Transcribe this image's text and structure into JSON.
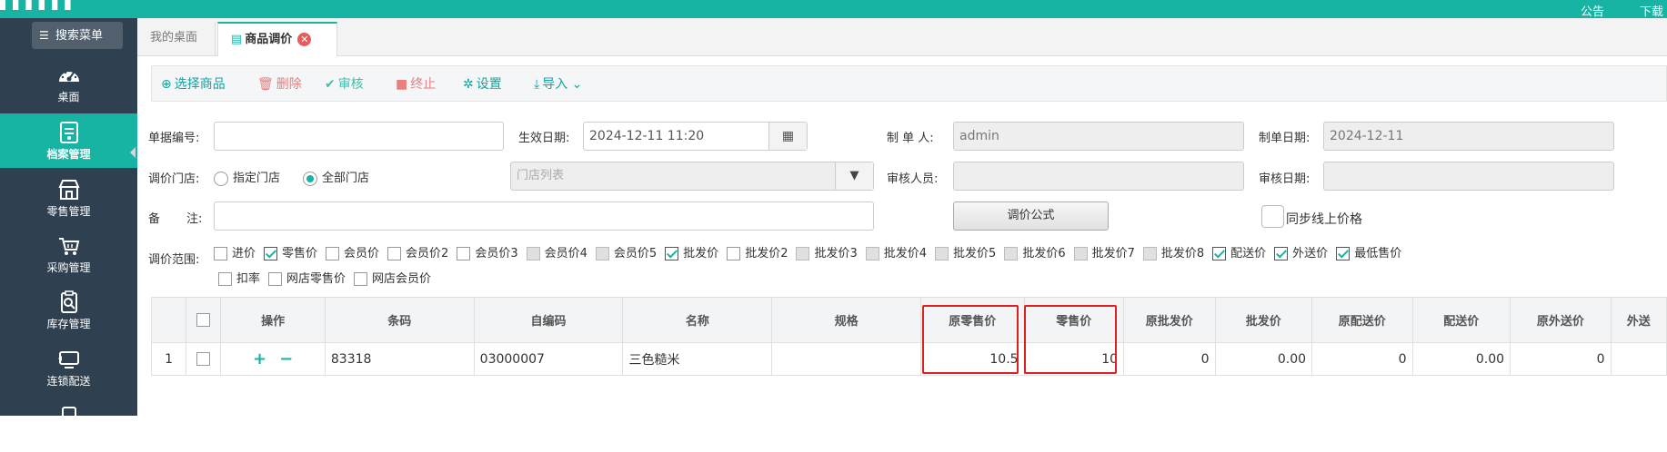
{
  "topbar": {
    "notice": "公告",
    "download": "下载"
  },
  "sidebar": {
    "search_label": "搜索菜单",
    "items": [
      {
        "label": "桌面",
        "icon": "dashboard-icon"
      },
      {
        "label": "档案管理",
        "icon": "archive-icon"
      },
      {
        "label": "零售管理",
        "icon": "store-icon"
      },
      {
        "label": "采购管理",
        "icon": "basket-icon"
      },
      {
        "label": "库存管理",
        "icon": "inventory-icon"
      },
      {
        "label": "连锁配送",
        "icon": "delivery-icon"
      }
    ]
  },
  "tabs": {
    "home": "我的桌面",
    "active": "商品调价"
  },
  "toolbar": {
    "select_goods": "选择商品",
    "delete": "删除",
    "audit": "审核",
    "terminate": "终止",
    "settings": "设置",
    "import": "导入"
  },
  "form": {
    "doc_no_label": "单据编号:",
    "doc_no_value": "",
    "effective_label": "生效日期:",
    "effective_value": "2024-12-11 11:20",
    "maker_label": "制 单 人:",
    "maker_value": "admin",
    "make_date_label": "制单日期:",
    "make_date_value": "2024-12-11",
    "store_label": "调价门店:",
    "store_opt_specific": "指定门店",
    "store_opt_all": "全部门店",
    "store_list_placeholder": "门店列表",
    "auditor_label": "审核人员:",
    "audit_date_label": "审核日期:",
    "remark_label_a": "备",
    "remark_label_b": "注:",
    "formula_button": "调价公式",
    "sync_label": "同步线上价格"
  },
  "scope": {
    "label": "调价范围:",
    "row1": [
      {
        "label": "进价",
        "checked": false,
        "disabled": false
      },
      {
        "label": "零售价",
        "checked": true,
        "disabled": false
      },
      {
        "label": "会员价",
        "checked": false,
        "disabled": false
      },
      {
        "label": "会员价2",
        "checked": false,
        "disabled": false
      },
      {
        "label": "会员价3",
        "checked": false,
        "disabled": false
      },
      {
        "label": "会员价4",
        "checked": false,
        "disabled": true
      },
      {
        "label": "会员价5",
        "checked": false,
        "disabled": true
      },
      {
        "label": "批发价",
        "checked": true,
        "disabled": false
      },
      {
        "label": "批发价2",
        "checked": false,
        "disabled": false
      },
      {
        "label": "批发价3",
        "checked": false,
        "disabled": true
      },
      {
        "label": "批发价4",
        "checked": false,
        "disabled": true
      },
      {
        "label": "批发价5",
        "checked": false,
        "disabled": true
      },
      {
        "label": "批发价6",
        "checked": false,
        "disabled": true
      },
      {
        "label": "批发价7",
        "checked": false,
        "disabled": true
      },
      {
        "label": "批发价8",
        "checked": false,
        "disabled": true
      },
      {
        "label": "配送价",
        "checked": true,
        "disabled": false
      },
      {
        "label": "外送价",
        "checked": true,
        "disabled": false
      },
      {
        "label": "最低售价",
        "checked": true,
        "disabled": false
      }
    ],
    "row2": [
      {
        "label": "扣率",
        "checked": false,
        "disabled": false
      },
      {
        "label": "网店零售价",
        "checked": false,
        "disabled": false
      },
      {
        "label": "网店会员价",
        "checked": false,
        "disabled": false
      }
    ]
  },
  "table": {
    "headers": [
      "",
      "",
      "操作",
      "条码",
      "自编码",
      "名称",
      "规格",
      "原零售价",
      "零售价",
      "原批发价",
      "批发价",
      "原配送价",
      "配送价",
      "原外送价",
      "外送"
    ],
    "rows": [
      {
        "index": "1",
        "barcode": "83318",
        "code": "03000007",
        "name": "三色糙米",
        "spec": "",
        "orig_retail": "10.5",
        "retail": "10",
        "orig_wholesale": "0",
        "wholesale": "0.00",
        "orig_delivery": "0",
        "delivery": "0.00",
        "orig_outsend": "0",
        "outsend": ""
      }
    ]
  }
}
